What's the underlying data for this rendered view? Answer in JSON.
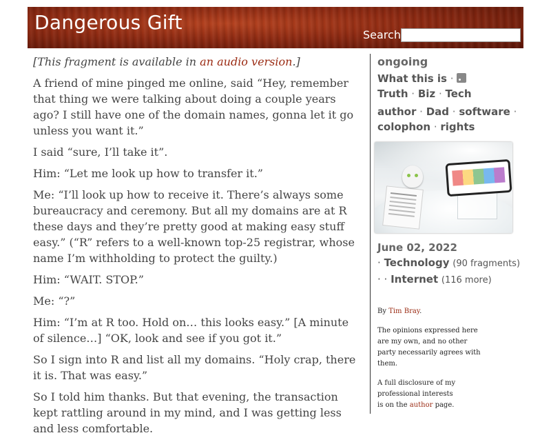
{
  "header": {
    "title": "Dangerous Gift",
    "search_label": "Search",
    "search_value": ""
  },
  "article": {
    "audio_note_prefix": "[This fragment is available in ",
    "audio_link": "an audio version",
    "audio_note_suffix": ".]",
    "paragraphs": [
      "A friend of mine pinged me online, said “Hey, remember that thing we were talking about doing a couple years ago? I still have one of the domain names, gonna let it go unless you want it.”",
      "I said “sure, I’ll take it”.",
      "Him: “Let me look up how to transfer it.”",
      "Me: “I’ll look up how to receive it. There’s always some bureaucracy and ceremony. But all my domains are at R these days and they’re pretty good at making easy stuff easy.” (“R” refers to a well-known top-25 registrar, whose name I’m withholding to protect the guilty.)",
      "Him: “WAIT. STOP.”",
      "Me: “?”",
      "Him: “I’m at R too. Hold on… this looks easy.” [A minute of silence…] “OK, look and see if you got it.”",
      "So I sign into R and list all my domains. “Holy crap, there it is. That was easy.”",
      "So I told him thanks. But that evening, the transaction kept rattling around in my mind, and I was getting less and less comfortable."
    ]
  },
  "sidebar": {
    "site_title": "ongoing",
    "nav": {
      "what": "What this is",
      "truth": "Truth",
      "biz": "Biz",
      "tech": "Tech",
      "author": "author",
      "dad": "Dad",
      "software": "software",
      "colophon": "colophon",
      "rights": "rights",
      "sep": "·"
    },
    "date_month_day": "June 02",
    "date_comma": ",",
    "date_year": "2022",
    "cat1_prefix": "·",
    "cat1": "Technology",
    "cat1_count": "(90 fragments)",
    "cat2_prefix": "· ·",
    "cat2": "Internet",
    "cat2_count": "(116 more)",
    "by_prefix": "By ",
    "by_name": "Tim Bray",
    "by_suffix": ".",
    "opinions": "The opinions expressed here are my own, and no other party necessarily agrees with them.",
    "disclosure_prefix": "A full disclosure of my professional interests is on the ",
    "disclosure_link": "author",
    "disclosure_suffix": " page."
  }
}
